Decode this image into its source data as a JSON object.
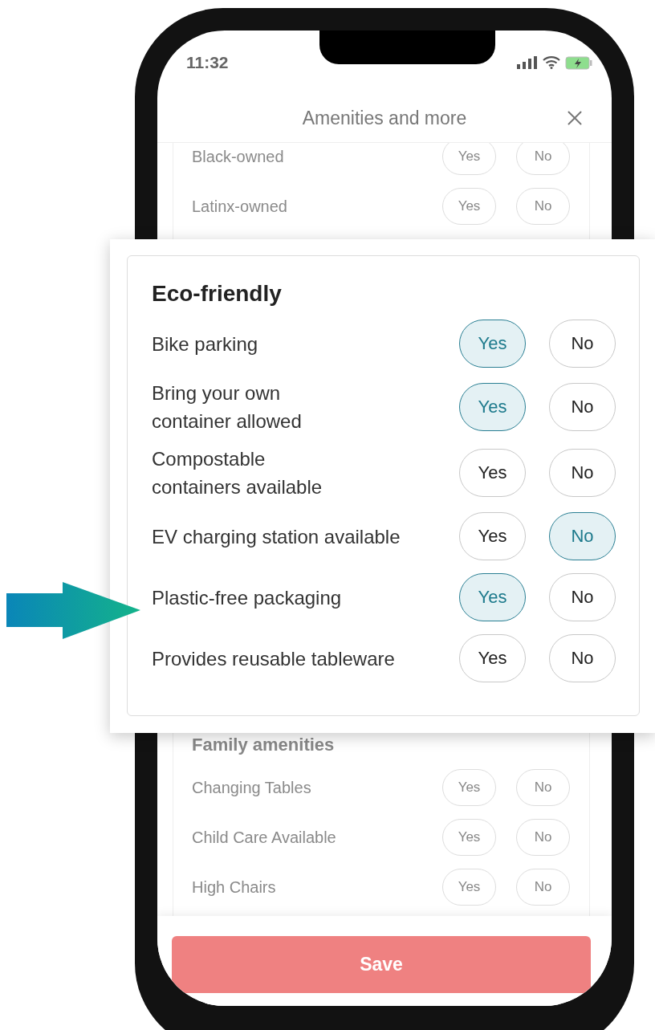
{
  "status_bar": {
    "time": "11:32"
  },
  "header": {
    "title": "Amenities and more"
  },
  "owned_rows": [
    {
      "label": "Black-owned",
      "options": [
        {
          "label": "Yes",
          "selected": false
        },
        {
          "label": "No",
          "selected": false
        }
      ]
    },
    {
      "label": "Latinx-owned",
      "options": [
        {
          "label": "Yes",
          "selected": false
        },
        {
          "label": "No",
          "selected": false
        }
      ]
    }
  ],
  "family": {
    "title": "Family amenities",
    "rows": [
      {
        "label": "Changing Tables",
        "options": [
          {
            "label": "Yes",
            "selected": false
          },
          {
            "label": "No",
            "selected": false
          }
        ]
      },
      {
        "label": "Child Care Available",
        "options": [
          {
            "label": "Yes",
            "selected": false
          },
          {
            "label": "No",
            "selected": false
          }
        ]
      },
      {
        "label": "High Chairs",
        "options": [
          {
            "label": "Yes",
            "selected": false
          },
          {
            "label": "No",
            "selected": false
          }
        ]
      }
    ]
  },
  "callout": {
    "title": "Eco-friendly",
    "rows": [
      {
        "label": "Bike parking",
        "options": [
          {
            "label": "Yes",
            "selected": true
          },
          {
            "label": "No",
            "selected": false
          }
        ]
      },
      {
        "label": "Bring your own\ncontainer allowed",
        "options": [
          {
            "label": "Yes",
            "selected": true
          },
          {
            "label": "No",
            "selected": false
          }
        ]
      },
      {
        "label": "Compostable\ncontainers available",
        "options": [
          {
            "label": "Yes",
            "selected": false
          },
          {
            "label": "No",
            "selected": false
          }
        ]
      },
      {
        "label": "EV charging station available",
        "options": [
          {
            "label": "Yes",
            "selected": false
          },
          {
            "label": "No",
            "selected": true
          }
        ]
      },
      {
        "label": "Plastic-free packaging",
        "options": [
          {
            "label": "Yes",
            "selected": true
          },
          {
            "label": "No",
            "selected": false
          }
        ]
      },
      {
        "label": "Provides reusable tableware",
        "options": [
          {
            "label": "Yes",
            "selected": false
          },
          {
            "label": "No",
            "selected": false
          }
        ]
      }
    ]
  },
  "save_button": "Save"
}
